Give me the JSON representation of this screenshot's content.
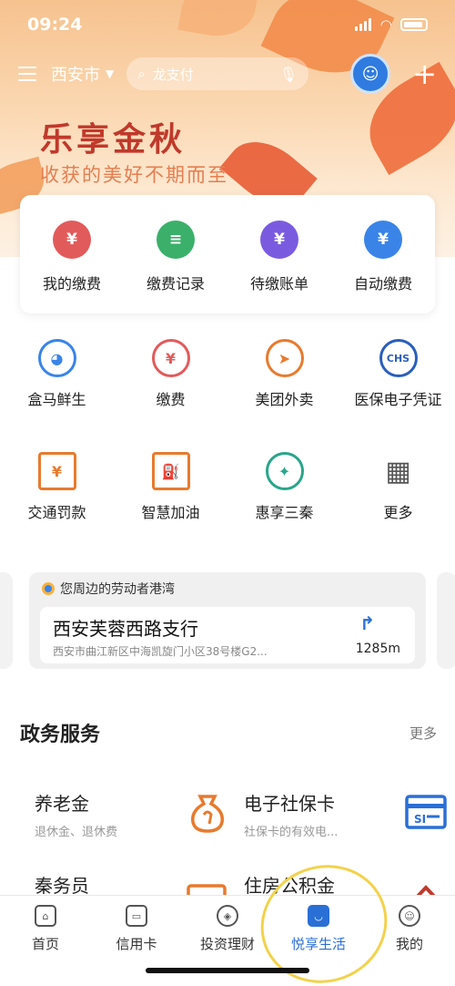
{
  "status": {
    "time": "09:24"
  },
  "topbar": {
    "city": "西安市",
    "search_placeholder": "龙支付"
  },
  "banner": {
    "title": "乐享金秋",
    "subtitle": "收获的美好不期而至"
  },
  "pay_items": [
    {
      "label": "我的缴费",
      "icon": "wallet-icon",
      "color": "#e25b5b"
    },
    {
      "label": "缴费记录",
      "icon": "record-icon",
      "color": "#3bb06a"
    },
    {
      "label": "待缴账单",
      "icon": "bill-icon",
      "color": "#7a5be0"
    },
    {
      "label": "自动缴费",
      "icon": "monitor-icon",
      "color": "#3a84e8"
    }
  ],
  "services": [
    {
      "label": "盒马鲜生",
      "icon": "hema-icon",
      "color": "#3a84e8",
      "glyph": "◕"
    },
    {
      "label": "缴费",
      "icon": "yuan-icon",
      "color": "#e25b5b",
      "glyph": "¥"
    },
    {
      "label": "美团外卖",
      "icon": "kangaroo-icon",
      "color": "#e87a2e",
      "glyph": "➤"
    },
    {
      "label": "医保电子凭证",
      "icon": "chs-icon",
      "color": "#2a5fbd",
      "glyph": "CHS"
    },
    {
      "label": "交通罚款",
      "icon": "traffic-fine-icon",
      "color": "#e87a2e",
      "glyph": "¥"
    },
    {
      "label": "智慧加油",
      "icon": "fuel-icon",
      "color": "#e87a2e",
      "glyph": "⛽"
    },
    {
      "label": "惠享三秦",
      "icon": "star-badge-icon",
      "color": "#2aa58a",
      "glyph": "✦"
    },
    {
      "label": "更多",
      "icon": "grid-more-icon",
      "color": "#555555",
      "glyph": "▦"
    }
  ],
  "nearby": {
    "header": "您周边的劳动者港湾",
    "branch": "西安芙蓉西路支行",
    "address": "西安市曲江新区中海凯旋门小区38号楼G2...",
    "distance": "1285m"
  },
  "gov": {
    "title": "政务服务",
    "more": "更多",
    "items": [
      {
        "name": "养老金",
        "desc": "退休金、退休费",
        "icon": "money-bag-icon"
      },
      {
        "name": "电子社保卡",
        "desc": "社保卡的有效电...",
        "icon": "si-card-icon"
      },
      {
        "name": "秦务员",
        "desc": "",
        "icon": "document-icon"
      },
      {
        "name": "住房公积金",
        "desc": "",
        "icon": "house-icon"
      }
    ]
  },
  "tabs": [
    {
      "label": "首页",
      "icon": "home-icon"
    },
    {
      "label": "信用卡",
      "icon": "card-icon"
    },
    {
      "label": "投资理财",
      "icon": "diamond-icon"
    },
    {
      "label": "悦享生活",
      "icon": "bag-icon",
      "active": true
    },
    {
      "label": "我的",
      "icon": "profile-icon"
    }
  ]
}
